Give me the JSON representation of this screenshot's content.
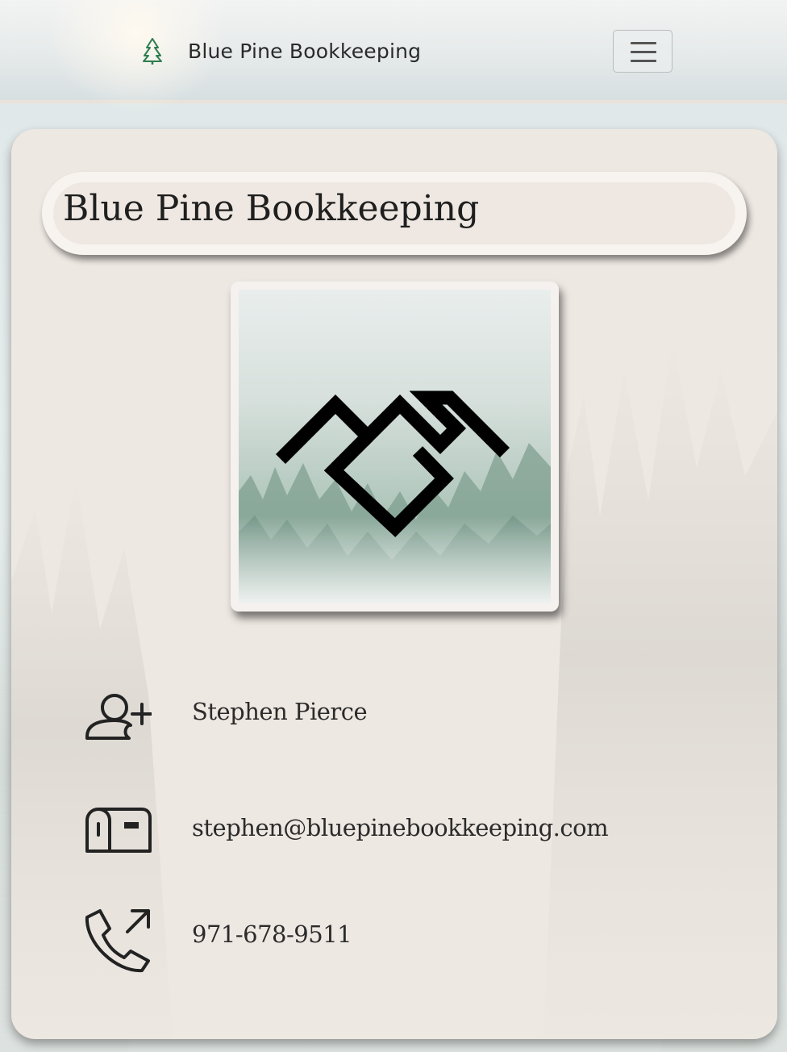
{
  "navbar": {
    "brand_icon": "pine-tree-icon",
    "brand_name": "Blue Pine Bookkeeping",
    "toggle_icon": "hamburger-menu-icon",
    "accent_color": "#2e7d4f"
  },
  "card": {
    "title": "Blue Pine Bookkeeping",
    "logo_icon": "twin-peaks-mountain-logo-icon"
  },
  "contact": {
    "name": "Stephen Pierce",
    "name_icon": "user-plus-icon",
    "email": "stephen@bluepinebookkeeping.com",
    "email_icon": "mailbox-icon",
    "phone": "971-678-9511",
    "phone_icon": "phone-outgoing-icon"
  }
}
